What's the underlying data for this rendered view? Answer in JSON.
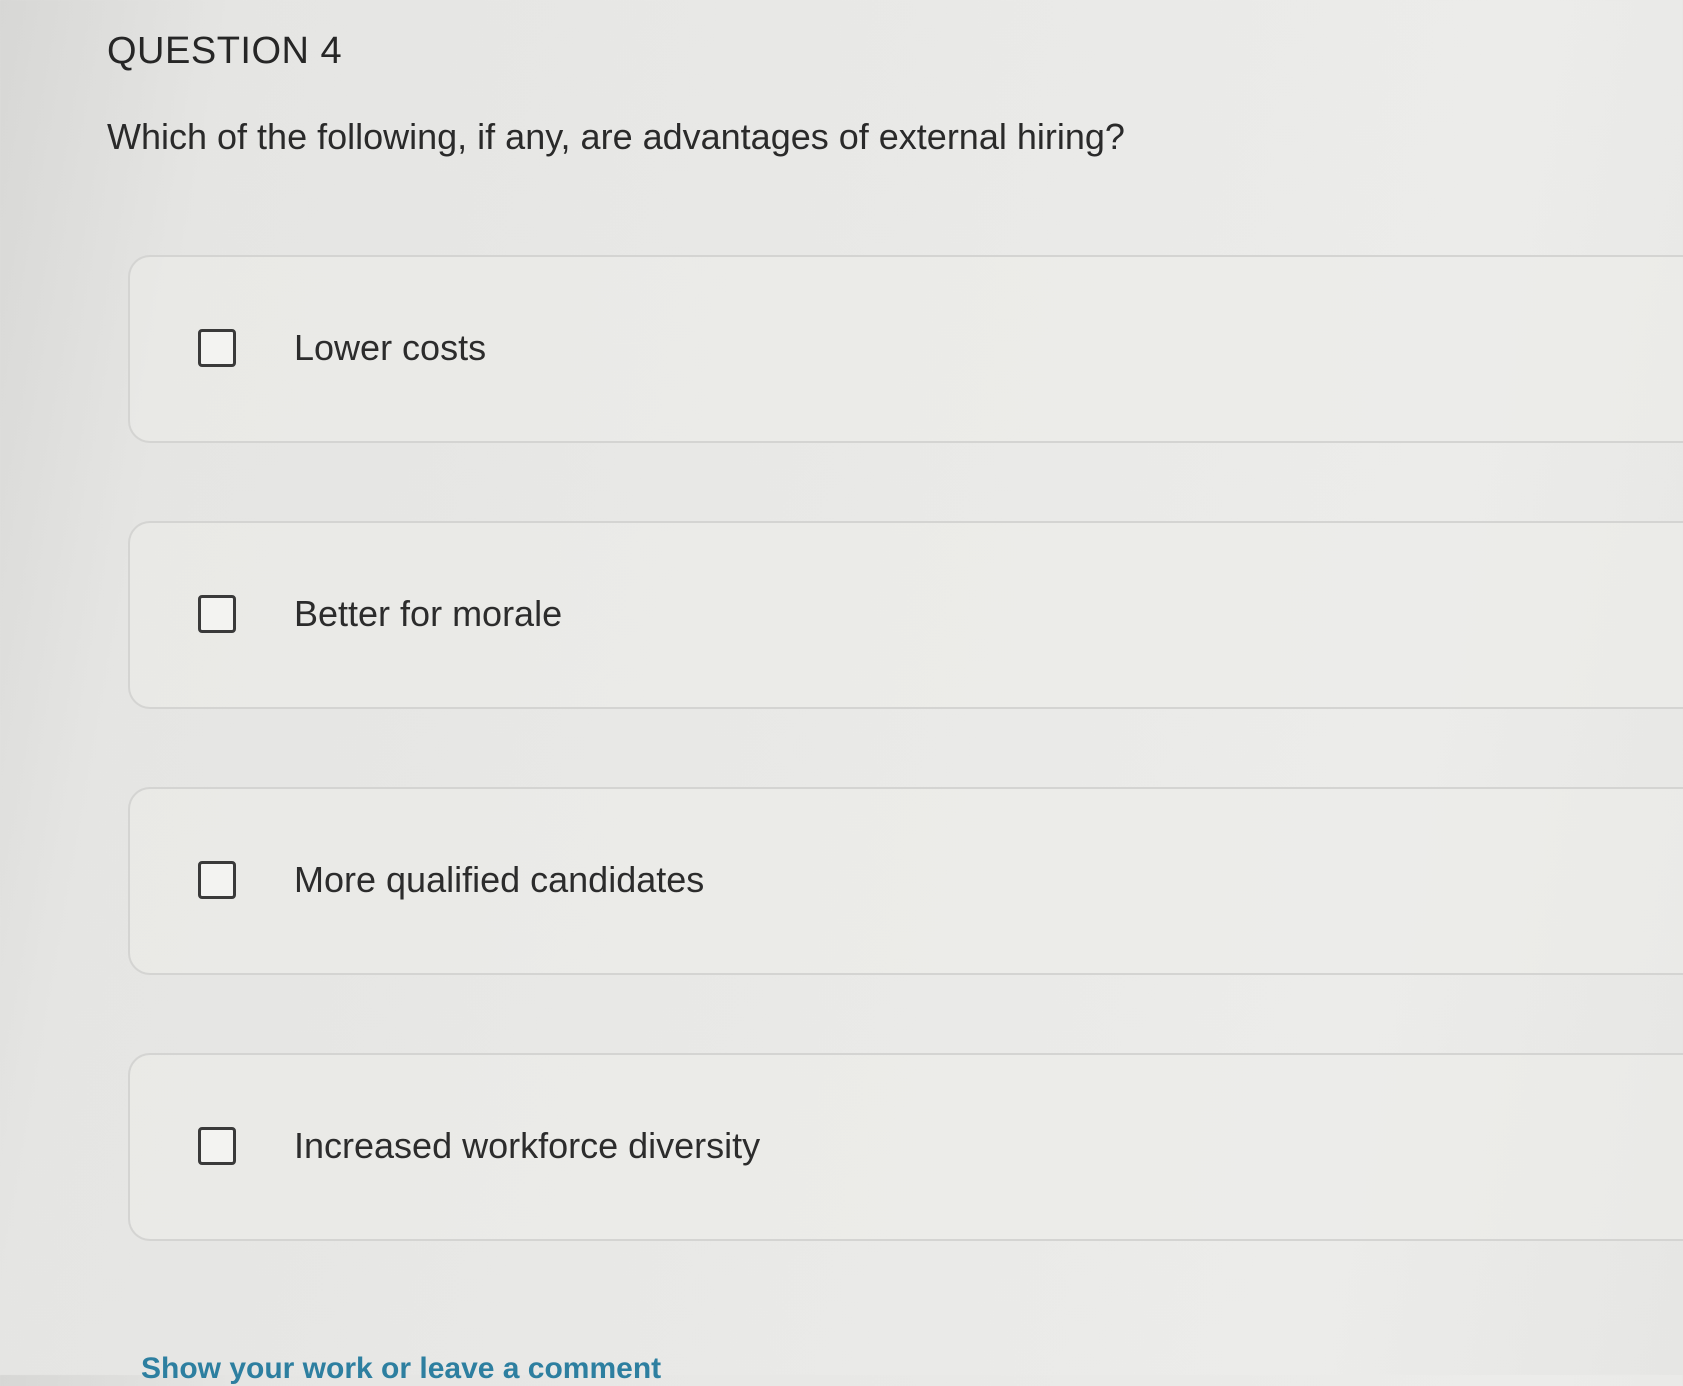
{
  "question": {
    "number": "QUESTION 4",
    "prompt": "Which of the following, if any, are advantages of external hiring?"
  },
  "options": [
    {
      "label": "Lower costs",
      "checked": false
    },
    {
      "label": "Better for morale",
      "checked": false
    },
    {
      "label": "More qualified candidates",
      "checked": false
    },
    {
      "label": "Increased workforce diversity",
      "checked": false
    }
  ],
  "footer": {
    "comment_link": "Show your work or leave a comment"
  }
}
